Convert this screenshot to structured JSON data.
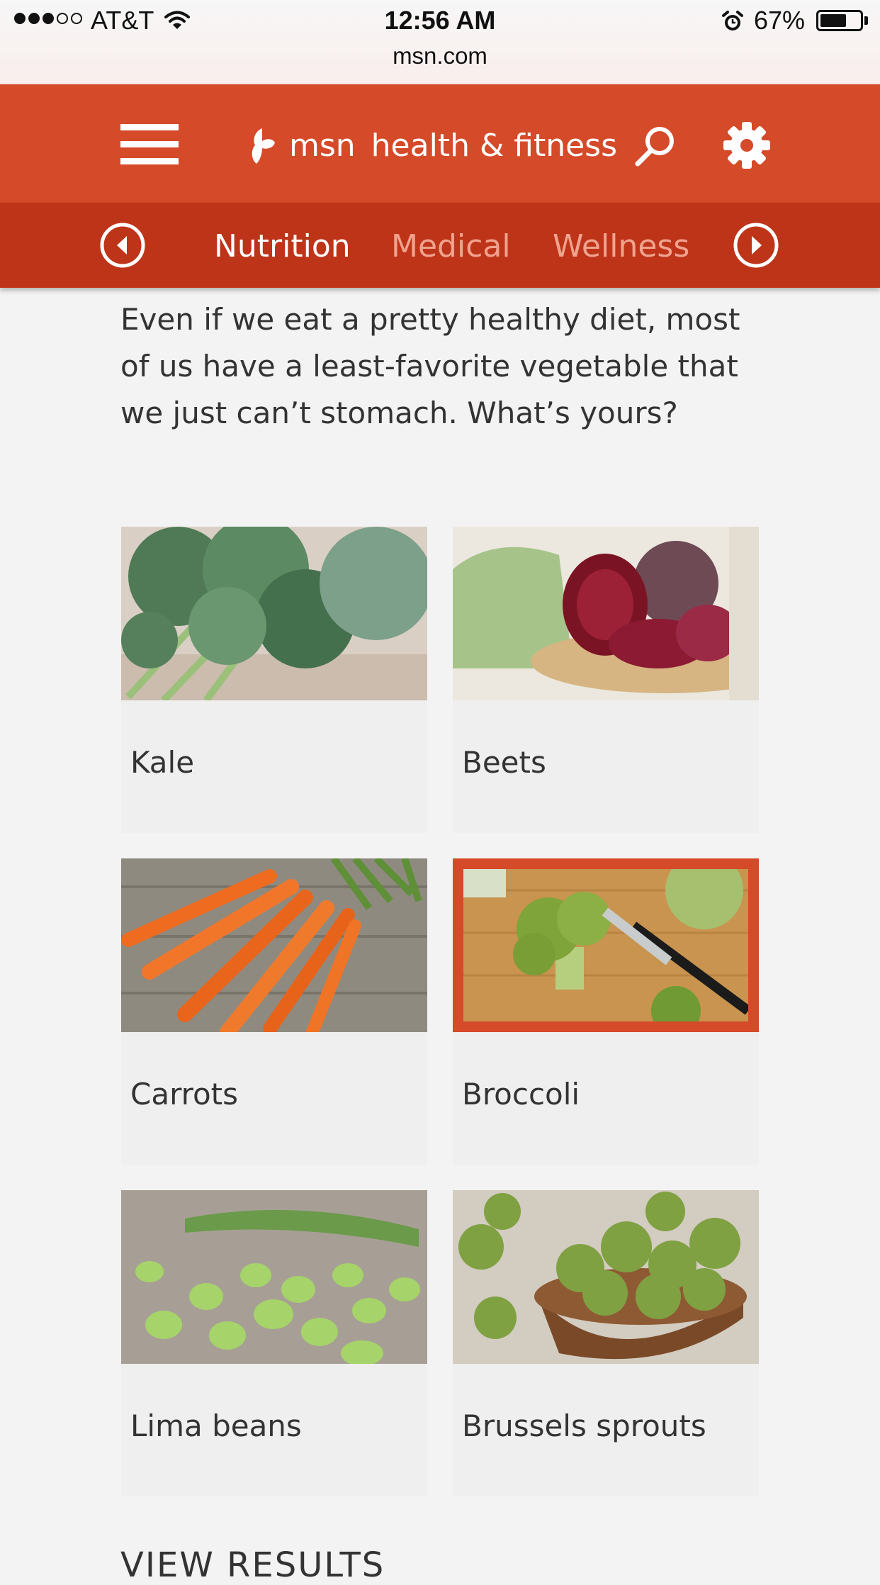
{
  "status_bar": {
    "carrier": "AT&T",
    "signal_bars_filled": 3,
    "signal_bars_total": 5,
    "time": "12:56 AM",
    "url": "msn.com",
    "battery_percent": "67%",
    "battery_level": 0.67
  },
  "header": {
    "brand_msn": "msn",
    "brand_section": "health & fitness",
    "accent_color": "#d54a29",
    "nav_color": "#be3419"
  },
  "nav": {
    "tabs": [
      {
        "label": "Nutrition",
        "active": true
      },
      {
        "label": "Medical",
        "active": false
      },
      {
        "label": "Wellness",
        "active": false
      }
    ]
  },
  "poll": {
    "intro": "Even if we eat a pretty healthy diet, most of us have a least-favorite vegetable that we just can’t stomach. What’s yours?",
    "options": [
      {
        "label": "Kale",
        "selected": false,
        "image": "kale-photo"
      },
      {
        "label": "Beets",
        "selected": false,
        "image": "beets-photo"
      },
      {
        "label": "Carrots",
        "selected": false,
        "image": "carrots-photo"
      },
      {
        "label": "Broccoli",
        "selected": true,
        "image": "broccoli-photo"
      },
      {
        "label": "Lima beans",
        "selected": false,
        "image": "lima-beans-photo"
      },
      {
        "label": "Brussels sprouts",
        "selected": false,
        "image": "brussels-sprouts-photo"
      }
    ],
    "view_results": "VIEW RESULTS"
  }
}
